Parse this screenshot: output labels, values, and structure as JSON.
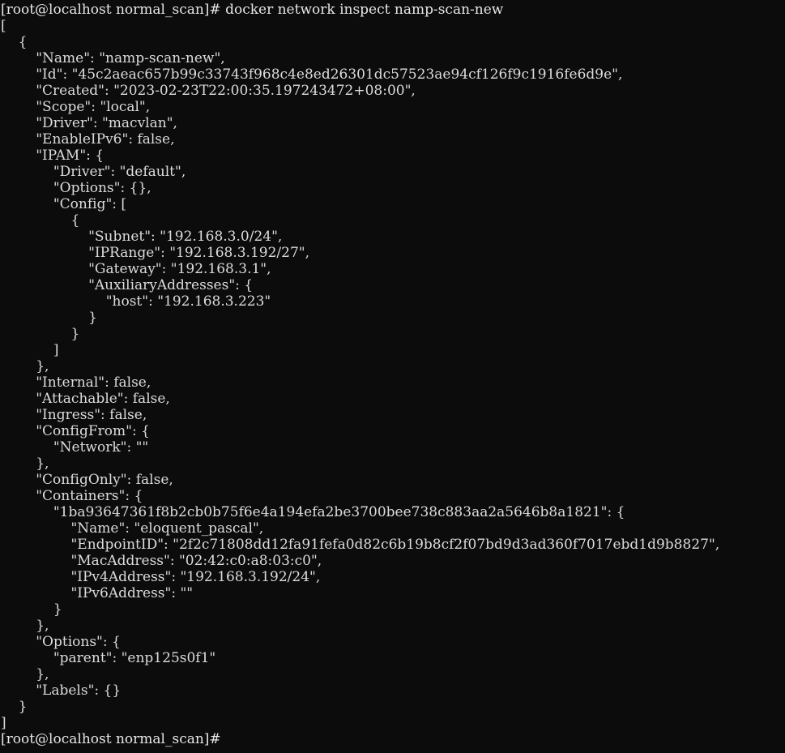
{
  "terminal": {
    "app": "bash-terminal",
    "background_color": "#0c0c0c",
    "foreground_color": "#dcdcdc",
    "prompt": "[root@localhost normal_scan]#",
    "command": "docker network inspect namp-scan-new",
    "prompt_line": "[root@localhost normal_scan]# docker network inspect namp-scan-new",
    "final_prompt_line": "[root@localhost normal_scan]#",
    "output_lines": [
      "[",
      "    {",
      "        \"Name\": \"namp-scan-new\",",
      "        \"Id\": \"45c2aeac657b99c33743f968c4e8ed26301dc57523ae94cf126f9c1916fe6d9e\",",
      "        \"Created\": \"2023-02-23T22:00:35.197243472+08:00\",",
      "        \"Scope\": \"local\",",
      "        \"Driver\": \"macvlan\",",
      "        \"EnableIPv6\": false,",
      "        \"IPAM\": {",
      "            \"Driver\": \"default\",",
      "            \"Options\": {},",
      "            \"Config\": [",
      "                {",
      "                    \"Subnet\": \"192.168.3.0/24\",",
      "                    \"IPRange\": \"192.168.3.192/27\",",
      "                    \"Gateway\": \"192.168.3.1\",",
      "                    \"AuxiliaryAddresses\": {",
      "                        \"host\": \"192.168.3.223\"",
      "                    }",
      "                }",
      "            ]",
      "        },",
      "        \"Internal\": false,",
      "        \"Attachable\": false,",
      "        \"Ingress\": false,",
      "        \"ConfigFrom\": {",
      "            \"Network\": \"\"",
      "        },",
      "        \"ConfigOnly\": false,",
      "        \"Containers\": {",
      "            \"1ba93647361f8b2cb0b75f6e4a194efa2be3700bee738c883aa2a5646b8a1821\": {",
      "                \"Name\": \"eloquent_pascal\",",
      "                \"EndpointID\": \"2f2c71808dd12fa91fefa0d82c6b19b8cf2f07bd9d3ad360f7017ebd1d9b8827\",",
      "                \"MacAddress\": \"02:42:c0:a8:03:c0\",",
      "                \"IPv4Address\": \"192.168.3.192/24\",",
      "                \"IPv6Address\": \"\"",
      "            }",
      "        },",
      "        \"Options\": {",
      "            \"parent\": \"enp125s0f1\"",
      "        },",
      "        \"Labels\": {}",
      "    }",
      "]"
    ],
    "network": {
      "Name": "namp-scan-new",
      "Id": "45c2aeac657b99c33743f968c4e8ed26301dc57523ae94cf126f9c1916fe6d9e",
      "Created": "2023-02-23T22:00:35.197243472+08:00",
      "Scope": "local",
      "Driver": "macvlan",
      "EnableIPv6": "false",
      "IPAM_Driver": "default",
      "IPAM_Options": "{}",
      "Subnet": "192.168.3.0/24",
      "IPRange": "192.168.3.192/27",
      "Gateway": "192.168.3.1",
      "AuxiliaryAddresses_host": "192.168.3.223",
      "Internal": "false",
      "Attachable": "false",
      "Ingress": "false",
      "ConfigFrom_Network": "",
      "ConfigOnly": "false",
      "Container_Id": "1ba93647361f8b2cb0b75f6e4a194efa2be3700bee738c883aa2a5646b8a1821",
      "Container_Name": "eloquent_pascal",
      "Container_EndpointID": "2f2c71808dd12fa91fefa0d82c6b19b8cf2f07bd9d3ad360f7017ebd1d9b8827",
      "Container_MacAddress": "02:42:c0:a8:03:c0",
      "Container_IPv4Address": "192.168.3.192/24",
      "Container_IPv6Address": "",
      "Options_parent": "enp125s0f1",
      "Labels": "{}"
    }
  }
}
